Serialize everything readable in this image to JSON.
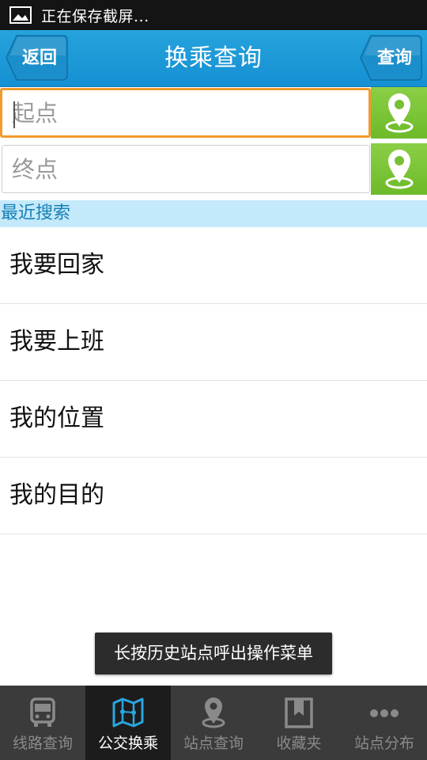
{
  "status_bar": {
    "text": "正在保存截屏...",
    "icon": "image-icon"
  },
  "header": {
    "back_label": "返回",
    "title": "换乘查询",
    "query_label": "查询"
  },
  "inputs": {
    "start_placeholder": "起点",
    "end_placeholder": "终点",
    "locate_icon": "map-pin-icon"
  },
  "recent": {
    "header": "最近搜索",
    "items": [
      "我要回家",
      "我要上班",
      "我的位置",
      "我的目的"
    ]
  },
  "toast": {
    "text": "长按历史站点呼出操作菜单"
  },
  "bottom_nav": {
    "items": [
      {
        "label": "线路查询",
        "icon": "bus-icon"
      },
      {
        "label": "公交换乘",
        "icon": "map-icon"
      },
      {
        "label": "站点查询",
        "icon": "map-pin-icon"
      },
      {
        "label": "收藏夹",
        "icon": "bookmark-icon"
      },
      {
        "label": "站点分布",
        "icon": "more-icon"
      }
    ],
    "active_index": 1
  },
  "colors": {
    "header": "#1a96d6",
    "accent_green": "#76c034",
    "focus_orange": "#f39a2c",
    "recent_bg": "#c4e9fb",
    "nav_bg": "#3b3b3b"
  }
}
